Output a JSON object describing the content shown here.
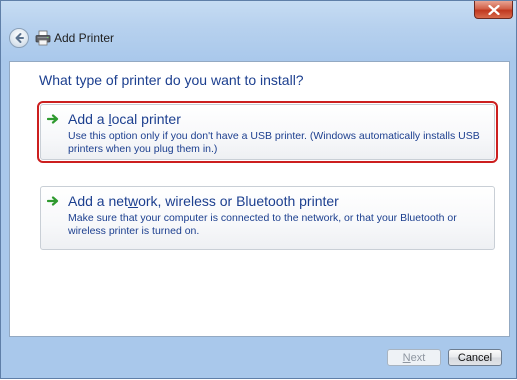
{
  "window": {
    "title": "Add Printer",
    "colors": {
      "accent_text": "#1c3f8f",
      "highlight_outline": "#cc1f1f",
      "close_button": "#c0381f"
    }
  },
  "titlebar": {
    "back_icon": "back-arrow-icon",
    "app_icon": "printer-icon",
    "close_icon": "close-icon"
  },
  "main": {
    "heading": "What type of printer do you want to install?",
    "options": [
      {
        "title": "Add a local printer",
        "mnemonic": "l",
        "description": "Use this option only if you don't have a USB printer. (Windows automatically installs USB printers when you plug them in.)",
        "icon": "green-arrow-icon",
        "highlighted": true
      },
      {
        "title": "Add a network, wireless or Bluetooth printer",
        "mnemonic": "w",
        "description": "Make sure that your computer is connected to the network, or that your Bluetooth or wireless printer is turned on.",
        "icon": "green-arrow-icon",
        "highlighted": false
      }
    ]
  },
  "footer": {
    "next_label": "Next",
    "next_enabled": false,
    "cancel_label": "Cancel"
  }
}
